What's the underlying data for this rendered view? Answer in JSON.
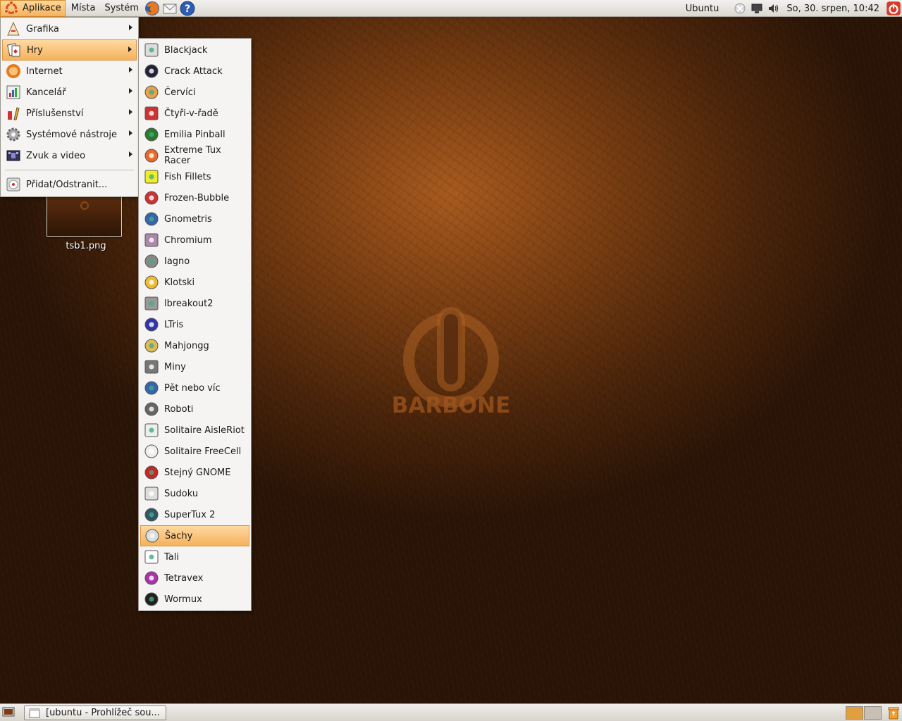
{
  "top_panel": {
    "menus": [
      "Aplikace",
      "Místa",
      "Systém"
    ],
    "active_menu": "Aplikace",
    "launchers": [
      "firefox-icon",
      "mail-icon",
      "help-icon"
    ],
    "user": "Ubuntu",
    "clock": "So, 30. srpen, 10:42",
    "tray": [
      "network-off-icon",
      "display-icon",
      "volume-icon",
      "power-icon"
    ]
  },
  "applications_menu": {
    "items": [
      {
        "label": "Grafika",
        "icon": "graphics-icon",
        "submenu": true
      },
      {
        "label": "Hry",
        "icon": "games-icon",
        "submenu": true,
        "highlighted": true
      },
      {
        "label": "Internet",
        "icon": "internet-icon",
        "submenu": true
      },
      {
        "label": "Kancelář",
        "icon": "office-icon",
        "submenu": true
      },
      {
        "label": "Příslušenství",
        "icon": "accessories-icon",
        "submenu": true
      },
      {
        "label": "Systémové nástroje",
        "icon": "system-tools-icon",
        "submenu": true
      },
      {
        "label": "Zvuk a video",
        "icon": "sound-video-icon",
        "submenu": true
      }
    ],
    "footer_item": {
      "label": "Přidat/Odstranit...",
      "icon": "add-remove-icon"
    }
  },
  "games_menu": {
    "items": [
      {
        "label": "Blackjack",
        "icon": "blackjack-icon"
      },
      {
        "label": "Crack Attack",
        "icon": "crack-attack-icon"
      },
      {
        "label": "Červíci",
        "icon": "worms-icon"
      },
      {
        "label": "Čtyři-v-řadě",
        "icon": "four-in-row-icon"
      },
      {
        "label": "Emilia Pinball",
        "icon": "pinball-icon"
      },
      {
        "label": "Extreme Tux Racer",
        "icon": "tux-racer-icon"
      },
      {
        "label": "Fish Fillets",
        "icon": "fish-fillets-icon"
      },
      {
        "label": "Frozen-Bubble",
        "icon": "frozen-bubble-icon"
      },
      {
        "label": "Gnometris",
        "icon": "gnometris-icon"
      },
      {
        "label": "Chromium",
        "icon": "chromium-skull-icon"
      },
      {
        "label": "Iagno",
        "icon": "iagno-icon"
      },
      {
        "label": "Klotski",
        "icon": "klotski-icon"
      },
      {
        "label": "lbreakout2",
        "icon": "lbreakout-icon"
      },
      {
        "label": "LTris",
        "icon": "ltris-icon"
      },
      {
        "label": "Mahjongg",
        "icon": "mahjongg-icon"
      },
      {
        "label": "Miny",
        "icon": "mines-icon"
      },
      {
        "label": "Pět nebo víc",
        "icon": "five-or-more-icon"
      },
      {
        "label": "Roboti",
        "icon": "robots-icon"
      },
      {
        "label": "Solitaire AisleRiot",
        "icon": "aisleriot-icon"
      },
      {
        "label": "Solitaire FreeCell",
        "icon": "freecell-icon"
      },
      {
        "label": "Stejný GNOME",
        "icon": "same-gnome-icon"
      },
      {
        "label": "Sudoku",
        "icon": "sudoku-icon"
      },
      {
        "label": "SuperTux 2",
        "icon": "supertux-icon"
      },
      {
        "label": "Šachy",
        "icon": "chess-icon",
        "highlighted": true
      },
      {
        "label": "Tali",
        "icon": "tali-dice-icon"
      },
      {
        "label": "Tetravex",
        "icon": "tetravex-icon"
      },
      {
        "label": "Wormux",
        "icon": "wormux-icon"
      }
    ]
  },
  "desktop": {
    "file_label": "tsb1.png",
    "wallpaper_text": "BARBONE"
  },
  "bottom_panel": {
    "task_label": "[ubuntu - Prohlížeč sou...",
    "workspace_colors": [
      "#e0a040",
      "#c8c0b4"
    ]
  }
}
